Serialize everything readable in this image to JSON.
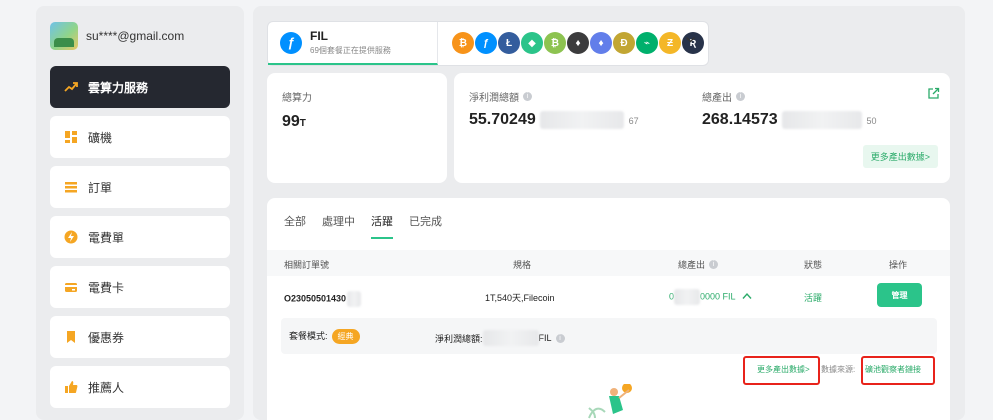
{
  "user": {
    "email": "su****@gmail.com"
  },
  "sidebar": {
    "items": [
      {
        "label": "雲算力服務",
        "icon": "trend-up-icon",
        "active": true
      },
      {
        "label": "礦機",
        "icon": "grid-icon",
        "active": false
      },
      {
        "label": "訂單",
        "icon": "list-icon",
        "active": false
      },
      {
        "label": "電費單",
        "icon": "bolt-icon",
        "active": false
      },
      {
        "label": "電費卡",
        "icon": "card-icon",
        "active": false
      },
      {
        "label": "優惠券",
        "icon": "coupon-icon",
        "active": false
      },
      {
        "label": "推薦人",
        "icon": "thumbs-up-icon",
        "active": false
      }
    ]
  },
  "coin_selector": {
    "current_name": "FIL",
    "current_sub": "69個套餐正在提供服務",
    "coins": [
      {
        "symbol": "₿",
        "color": "#f7931a"
      },
      {
        "symbol": "ƒ",
        "color": "#0090ff"
      },
      {
        "symbol": "Ł",
        "color": "#345d9d"
      },
      {
        "symbol": "◆",
        "color": "#2bc48a"
      },
      {
        "symbol": "₿",
        "color": "#8dc351"
      },
      {
        "symbol": "♦",
        "color": "#3c3c3d"
      },
      {
        "symbol": "♦",
        "color": "#627eea"
      },
      {
        "symbol": "Ð",
        "color": "#c2a633"
      },
      {
        "symbol": "⌁",
        "color": "#00b06c"
      },
      {
        "symbol": "Ƶ",
        "color": "#f4b728"
      },
      {
        "symbol": "Ʀ",
        "color": "#28334a"
      }
    ]
  },
  "stats": {
    "total_power_label": "總算力",
    "total_power_value": "99",
    "total_power_unit": "T",
    "net_income_label": "淨利潤總額",
    "net_income_value": "55.70249",
    "net_income_tail": "67",
    "total_output_label": "總產出",
    "total_output_value": "268.14573",
    "total_output_tail": "50",
    "more_button": "更多產出數據>"
  },
  "orders": {
    "tabs": [
      {
        "label": "全部",
        "active": false
      },
      {
        "label": "處理中",
        "active": false
      },
      {
        "label": "活躍",
        "active": true
      },
      {
        "label": "已完成",
        "active": false
      }
    ],
    "columns": [
      "相關訂單號",
      "規格",
      "總產出",
      "狀態",
      "操作"
    ],
    "row": {
      "order_no": "O23050501430",
      "spec": "1T,540天,Filecoin",
      "output_prefix": "0",
      "output_suffix": "0000 FIL",
      "status": "活躍",
      "action": "管理"
    },
    "detail": {
      "plan_label": "套餐模式:",
      "plan_badge": "經典",
      "net_label": "淨利潤總額:",
      "net_unit": "FIL"
    },
    "links": {
      "more_output": "更多產出數據>",
      "data_source": "數據來源:",
      "pool_link": "礦池觀察者鏈接"
    }
  },
  "colors": {
    "accent": "#2bc48a",
    "highlight": "#e8231b",
    "dark": "#252830"
  }
}
